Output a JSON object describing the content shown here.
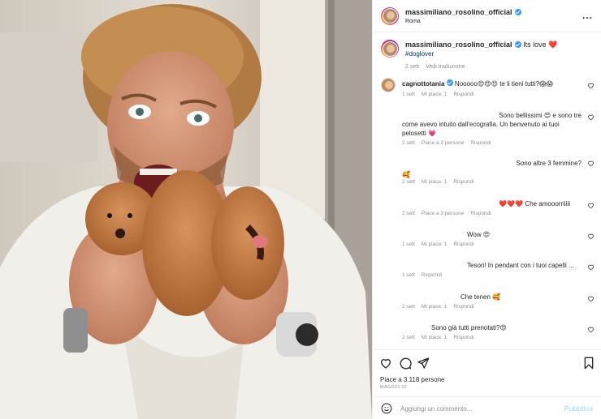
{
  "post": {
    "username": "massimiliano_rosolino_official",
    "location": "Roma",
    "more_label": "...",
    "caption_text": "Its love ❤️",
    "hashtag": "#doglover",
    "caption_time": "2 sett",
    "translate_label": "Vedi traduzione"
  },
  "comments": [
    {
      "user": "cagnottotania",
      "text": "Nooooo😍😍😍 te li tieni tutti?😱😱",
      "time": "1 sett",
      "likes": "Mi piace: 1",
      "reply": "Rispondi"
    },
    {
      "text1": "Sono bellissimi 😍 e sono tre",
      "text2": "come avevo intuito dall'ecografia. Un benvenuto ai tuoi",
      "text3": "pelosetti 💗",
      "time": "2 sett",
      "likes": "Piace a 2 persone",
      "reply": "Rispondi"
    },
    {
      "text1": "Sono altre 3 femmine?",
      "text2": "🥰",
      "time": "2 sett",
      "likes": "Mi piace: 1",
      "reply": "Rispondi"
    },
    {
      "text": "❤️❤️❤️ Che amooorriiiii",
      "time": "2 sett",
      "likes": "Piace a 3 persone",
      "reply": "Rispondi"
    },
    {
      "text": "Wow 😍",
      "time": "1 sett",
      "likes": "Mi piace: 1",
      "reply": "Rispondi"
    },
    {
      "text": "Tesori! In pendant con i tuoi capelli ...",
      "time": "1 sett",
      "reply": "Rispondi"
    },
    {
      "text": "Che tenen 🥰",
      "time": "2 sett",
      "likes": "Mi piace: 1",
      "reply": "Rispondi"
    },
    {
      "text": "Sono già tutti prenotati?😍",
      "time": "2 sett",
      "likes": "Mi piace: 1",
      "reply": "Rispondi"
    }
  ],
  "actions": {
    "likes_text": "Piace a 3.118 persone",
    "date_text": "MAGGIO 22",
    "comment_placeholder": "Aggiungi un commento...",
    "publish_label": "Pubblica"
  },
  "colors": {
    "verified": "#3897f0",
    "heart": "#ed4956",
    "link": "#00376b",
    "muted": "#8e8e8e",
    "publish_disabled": "#b2dffc"
  }
}
